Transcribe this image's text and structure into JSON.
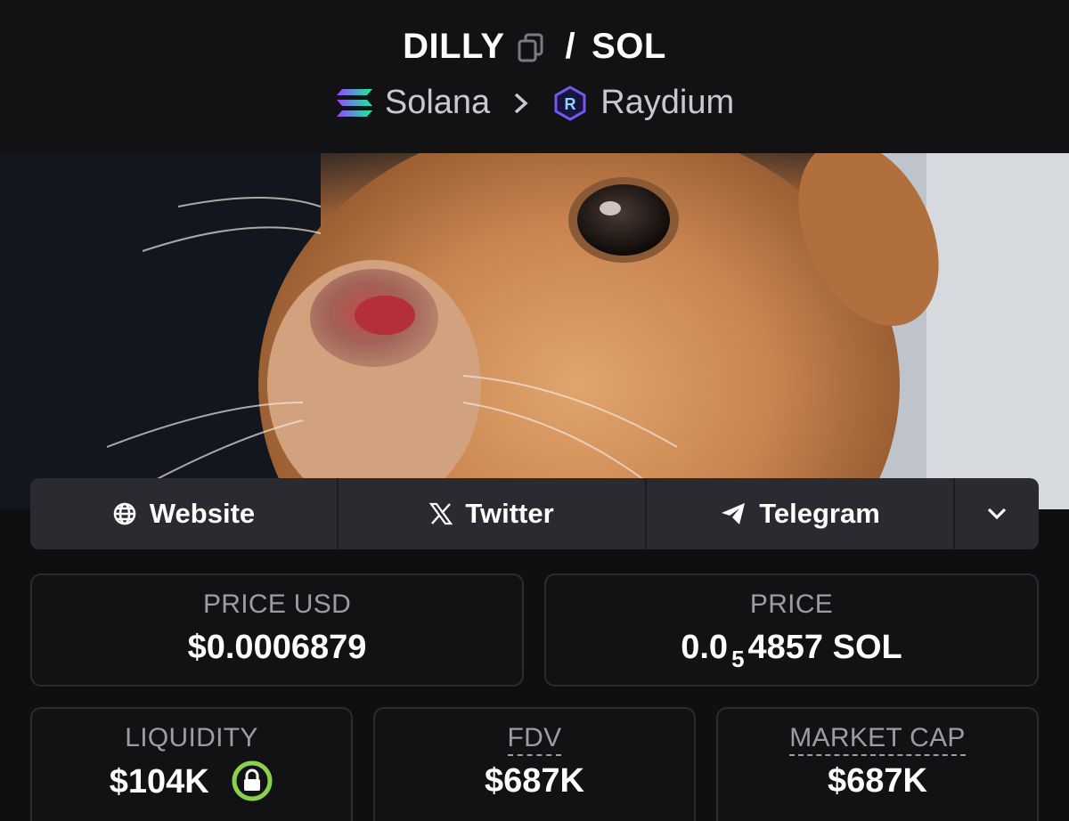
{
  "header": {
    "base_token": "DILLY",
    "separator": "/",
    "quote_token": "SOL",
    "chain": "Solana",
    "dex": "Raydium"
  },
  "links": {
    "website": "Website",
    "twitter": "Twitter",
    "telegram": "Telegram"
  },
  "stats": {
    "price_usd": {
      "label": "PRICE USD",
      "value": "$0.0006879"
    },
    "price": {
      "label": "PRICE",
      "value_prefix": "0.0",
      "value_subscript": "5",
      "value_suffix": "4857 SOL"
    },
    "liquidity": {
      "label": "LIQUIDITY",
      "value": "$104K"
    },
    "fdv": {
      "label": "FDV",
      "value": "$687K"
    },
    "market_cap": {
      "label": "MARKET CAP",
      "value": "$687K"
    }
  },
  "colors": {
    "background": "#0f0f12",
    "card_border": "#2b2b31",
    "links_bar": "#2a2a30",
    "label_gray": "#9c9ca6",
    "lock_green": "#8bd14a"
  },
  "icons": {
    "copy": "copy-icon",
    "chain": "solana-logo-icon",
    "chevron": "chevron-right-icon",
    "dex": "raydium-logo-icon",
    "website": "globe-icon",
    "twitter": "x-icon",
    "telegram": "telegram-icon",
    "more": "chevron-down-icon",
    "lock": "lock-icon"
  }
}
